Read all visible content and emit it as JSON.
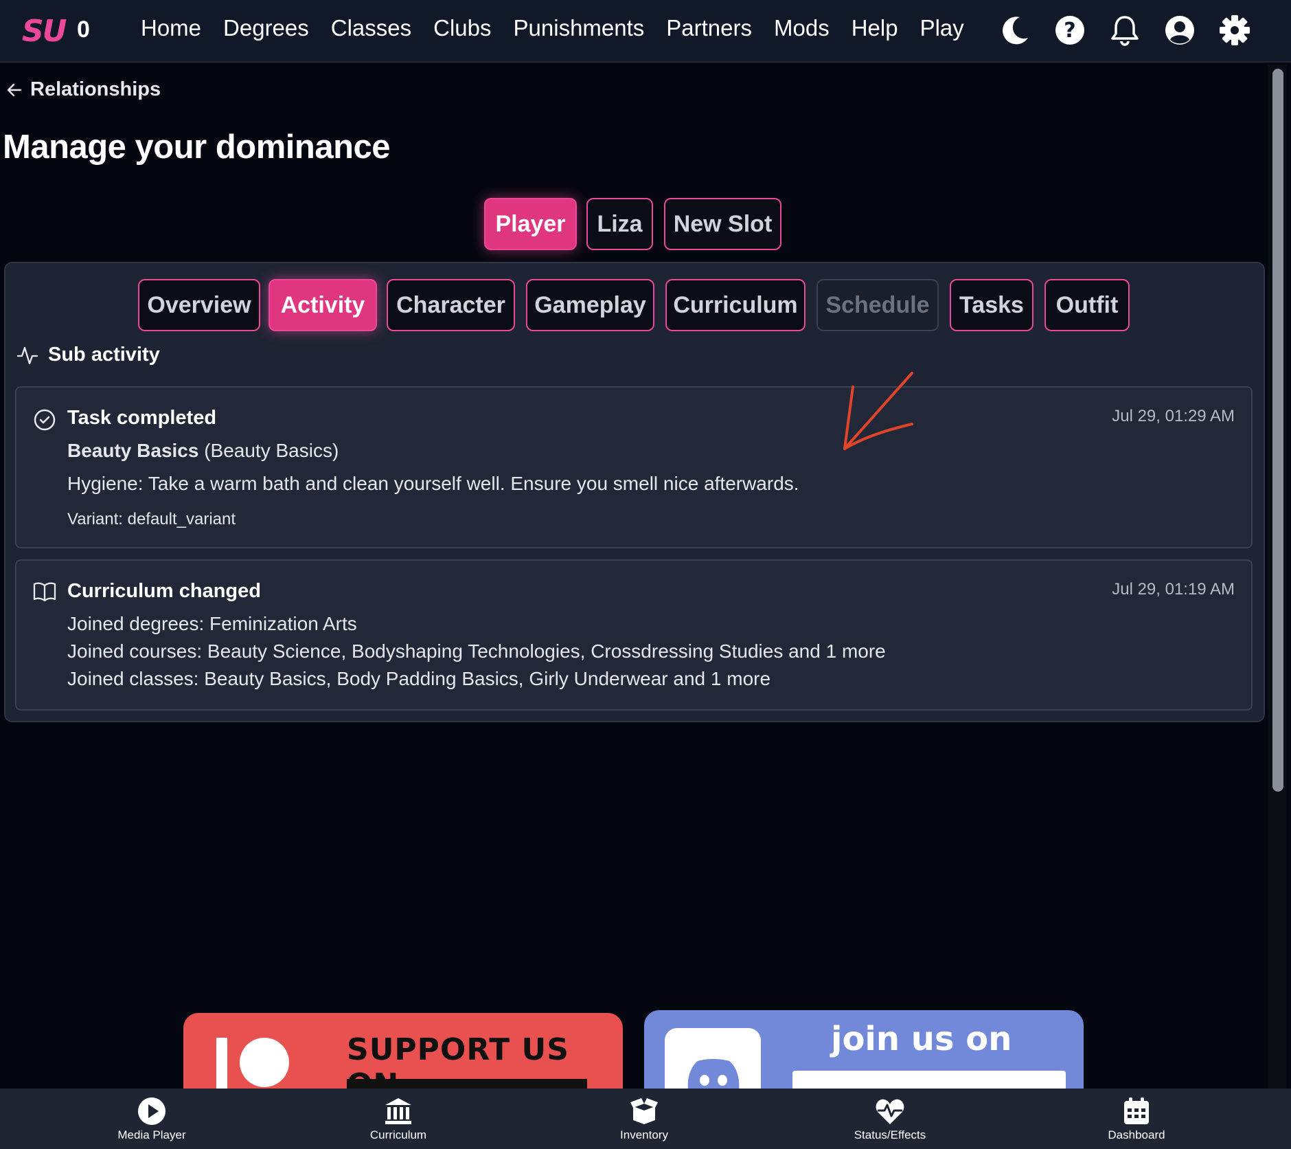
{
  "header": {
    "logo": "SU",
    "coins": "0",
    "nav": [
      "Home",
      "Degrees",
      "Classes",
      "Clubs",
      "Punishments",
      "Partners",
      "Mods",
      "Help",
      "Play"
    ],
    "icons": [
      "moon-icon",
      "help-icon",
      "bell-icon",
      "user-icon",
      "gear-icon"
    ]
  },
  "breadcrumb": {
    "label": "Relationships"
  },
  "page": {
    "title": "Manage your dominance"
  },
  "slots": [
    {
      "label": "Player",
      "state": "active"
    },
    {
      "label": "Liza",
      "state": "normal"
    },
    {
      "label": "New Slot",
      "state": "normal"
    }
  ],
  "tabs": [
    {
      "label": "Overview",
      "state": "normal"
    },
    {
      "label": "Activity",
      "state": "active"
    },
    {
      "label": "Character",
      "state": "normal"
    },
    {
      "label": "Gameplay",
      "state": "normal"
    },
    {
      "label": "Curriculum",
      "state": "normal"
    },
    {
      "label": "Schedule",
      "state": "disabled"
    },
    {
      "label": "Tasks",
      "state": "normal"
    },
    {
      "label": "Outfit",
      "state": "normal"
    }
  ],
  "section": {
    "label": "Sub activity"
  },
  "activities": [
    {
      "type": "Task completed",
      "timestamp": "Jul 29, 01:29 AM",
      "task_name": "Beauty Basics",
      "task_class": "(Beauty Basics)",
      "description": "Hygiene: Take a warm bath and clean yourself well. Ensure you smell nice afterwards.",
      "variant": "Variant: default_variant"
    },
    {
      "type": "Curriculum changed",
      "timestamp": "Jul 29, 01:19 AM",
      "lines": [
        "Joined degrees: Feminization Arts",
        "Joined courses: Beauty Science, Bodyshaping Technologies, Crossdressing Studies and 1 more",
        "Joined classes: Beauty Basics, Body Padding Basics, Girly Underwear and 1 more"
      ]
    }
  ],
  "banners": {
    "patreon": "SUPPORT US ON",
    "discord": "join us on"
  },
  "bottom_nav": [
    "Media Player",
    "Curriculum",
    "Inventory",
    "Status/Effects",
    "Dashboard"
  ],
  "colors": {
    "accent": "#ec4899",
    "background": "#050710",
    "panel": "#1e2433",
    "patreon": "#e8514f",
    "discord": "#7289da",
    "annotation_arrow": "#e0442a"
  }
}
